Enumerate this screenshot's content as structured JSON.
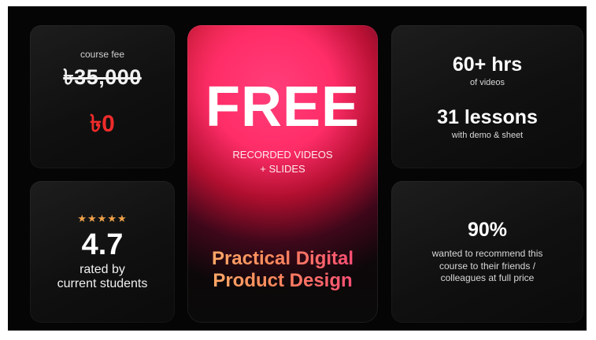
{
  "fee": {
    "label": "course fee",
    "old_price": "৳35,000",
    "new_price": "৳0"
  },
  "rating": {
    "stars": "★★★★★",
    "value": "4.7",
    "caption_line1": "rated by",
    "caption_line2": "current students",
    "star_color": "#f0a24a"
  },
  "hero": {
    "headline": "FREE",
    "sub_line1": "RECORDED VIDEOS",
    "sub_line2": "+ SLIDES",
    "course_line1": "Practical Digital",
    "course_line2": "Product Design",
    "accent_color": "#ff2d68"
  },
  "stats": {
    "hours": "60+ hrs",
    "hours_note": "of videos",
    "lessons": "31 lessons",
    "lessons_note": "with demo & sheet"
  },
  "recommend": {
    "percent": "90%",
    "note_line1": "wanted to recommend this",
    "note_line2": "course to their friends /",
    "note_line3": "colleagues at full price"
  }
}
